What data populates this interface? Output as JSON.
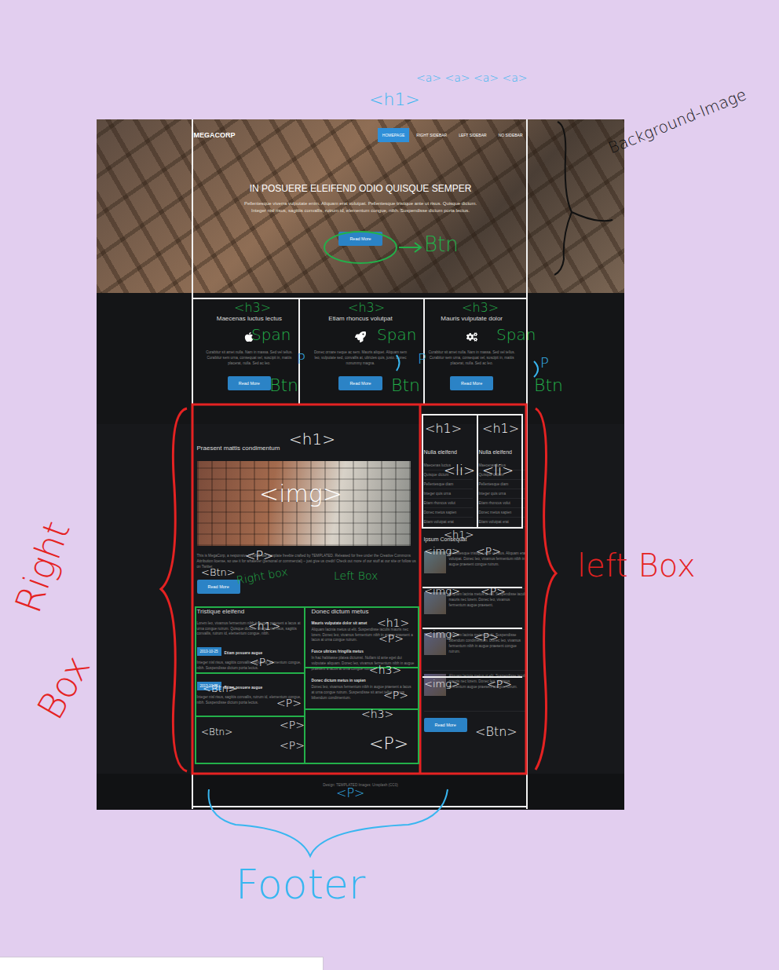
{
  "site": {
    "logo": "MEGACORP",
    "nav": [
      {
        "label": "HOMEPAGE",
        "selected": true
      },
      {
        "label": "RIGHT SIDEBAR",
        "selected": false
      },
      {
        "label": "LEFT SIDEBAR",
        "selected": false
      },
      {
        "label": "NO SIDEBAR",
        "selected": false
      }
    ],
    "hero": {
      "title": "IN POSUERE ELEIFEND ODIO QUISQUE SEMPER",
      "text": "Pellentesque viverra vulputate enim. Aliquam erat volutpat. Pellentesque tristique ante ut risus. Quisque dictum. Integer nisl risus, sagittis convallis, rutrum id, elementum congue, nibh. Suspendisse dictum porta lectus.",
      "button": "Read More"
    },
    "features": [
      {
        "title": "Maecenas luctus lectus",
        "text": "Curabitur sit amet nulla. Nam in massa. Sed vel tellus. Curabitur sem urna, consequat vel, suscipit in, mattis placerat, nulla. Sed ac leo.",
        "button": "Read More"
      },
      {
        "title": "Etiam rhoncus volutpat",
        "text": "Donec ornare neque ac sem. Mauris aliquet. Aliquam sem leo, vulputate sed, convallis at, ultricies quis, justo. Donec nonummy magna.",
        "button": "Read More"
      },
      {
        "title": "Mauris vulputate dolor",
        "text": "Curabitur sit amet nulla. Nam in massa. Sed vel tellus. Curabitur sem urna, consequat vel, suscipit in, mattis placerat, nulla. Sed ac leo.",
        "button": "Read More"
      }
    ],
    "main": {
      "title": "Praesent mattis condimentum",
      "text": "This is MegaCorp, a responsive HTML5 site template freebie crafted by TEMPLATED. Released for free under the Creative Commons Attribution license, so use it for whatever (personal or commercial) – just give us credit! Check out more of our stuff at our site or follow us on Twitter.",
      "button": "Read More"
    },
    "intro": {
      "title": "Tristique eleifend",
      "text": "Lorem leo, vivamus fermentum nibh in augue praesent a lacus at urna congue rutrum. Quisque dictum. Integer nisl risus, sagittis convallis, rutrum id, elementum congue, nibh."
    },
    "posts": [
      {
        "date": "2013-10-25",
        "title": "Etiam posuere augue",
        "text": "Integer nisl risus, sagittis convallis, rutrum id, elementum congue, nibh. Suspendisse dictum porta lectus."
      },
      {
        "date": "2013-10-25",
        "title": "Etiam posuere augue",
        "text": "Integer nisl risus, sagittis convallis, rutrum id, elementum congue, nibh. Suspendisse dictum porta lectus."
      }
    ],
    "articles": {
      "title": "Donec dictum metus",
      "items": [
        {
          "title": "Mauris vulputate dolor sit amet",
          "text": "Aliquam lacinia metus ut elit. Suspendisse iaculis mauris nec lorem. Donec leo, vivamus fermentum nibh in augue praesent a lacus at urna congue rutrum."
        },
        {
          "title": "Fusce ultrices fringilla metus",
          "text": "In hac habitasse platea dictumst. Nullam id ante eget dui vulputate aliquam. Donec leo, vivamus fermentum nibh in augue praesent a lacus at urna congue rutrum."
        },
        {
          "title": "Donec dictum metus in sapien",
          "text": "Donec leo, vivamus fermentum nibh in augue praesent a lacus at urna congue rutrum. Suspendisse sit amet tellus in eros bibendum condimentum."
        }
      ]
    },
    "lists": [
      {
        "title": "Nulla eleifend",
        "items": [
          "Maecenas luctus",
          "Quisque dictum",
          "Pellentesque diam",
          "Integer quis urna",
          "Etiam rhoncus volut",
          "Donec metus sapien",
          "Etiam volutpat erat"
        ]
      },
      {
        "title": "Nulla eleifend",
        "items": [
          "Maecenas luctus",
          "Quisque dictum",
          "Pellentesque diam",
          "Integer quis urna",
          "Etiam rhoncus volut",
          "Donec metus sapien",
          "Etiam volutpat erat"
        ]
      }
    ],
    "gallery": {
      "title": "Ipsum Consequat",
      "items": [
        "Pellentesque tristique ante ut risus. Aliquam erat volutpat. Donec leo, vivamus fermentum nibh in augue praesent congue rutrum.",
        "Aliquam lacinia metus ut elit. Suspendisse iaculis mauris nec lorem. Donec leo, vivamus fermentum augue praesent.",
        "Aliquam lacinia metus ut elit. Suspendisse bibendum condimentum. Donec leo, vivamus fermentum nibh in augue praesent congue rutrum.",
        "Aliquam lacinia metus ut elit. Suspendisse iaculis mauris nec lorem. Donec leo, vivamus fermentum augue praesent congue rutrum."
      ],
      "button": "Read More"
    },
    "footer": "Design: TEMPLATED Images: Unsplash (CC0)"
  },
  "annotations": [
    {
      "text": "<h1>",
      "color": "#38b6f0"
    },
    {
      "text": "<a> <a> <a> <a>",
      "color": "#38b6f0"
    },
    {
      "text": "Background-Image",
      "color": "#111111"
    },
    {
      "text": "Btn",
      "color": "#23b04a"
    },
    {
      "text": "<h3>",
      "color": "#23b04a"
    },
    {
      "text": "<h3>",
      "color": "#23b04a"
    },
    {
      "text": "<h3>",
      "color": "#23b04a"
    },
    {
      "text": "Span",
      "color": "#23b04a"
    },
    {
      "text": "Span",
      "color": "#23b04a"
    },
    {
      "text": "Span",
      "color": "#23b04a"
    },
    {
      "text": "P",
      "color": "#38b6f0"
    },
    {
      "text": "P",
      "color": "#38b6f0"
    },
    {
      "text": "P",
      "color": "#38b6f0"
    },
    {
      "text": "Btn",
      "color": "#23b04a"
    },
    {
      "text": "Btn",
      "color": "#23b04a"
    },
    {
      "text": "Btn",
      "color": "#23b04a"
    },
    {
      "text": "<h1>",
      "color": "#ffffff"
    },
    {
      "text": "<img>",
      "color": "#ffffff"
    },
    {
      "text": "<P>",
      "color": "#ffffff"
    },
    {
      "text": "<Btn>",
      "color": "#ffffff"
    },
    {
      "text": "Right box",
      "color": "#23b04a"
    },
    {
      "text": "Left Box",
      "color": "#23b04a"
    },
    {
      "text": "<h1>",
      "color": "#ffffff"
    },
    {
      "text": "<h1>",
      "color": "#ffffff"
    },
    {
      "text": "<li>",
      "color": "#ffffff"
    },
    {
      "text": "<li>",
      "color": "#ffffff"
    },
    {
      "text": "<h1>",
      "color": "#ffffff"
    },
    {
      "text": "<img>",
      "color": "#ffffff"
    },
    {
      "text": "<P>",
      "color": "#ffffff"
    },
    {
      "text": "<img>",
      "color": "#ffffff"
    },
    {
      "text": "<P>",
      "color": "#ffffff"
    },
    {
      "text": "<img>",
      "color": "#ffffff"
    },
    {
      "text": "<P>",
      "color": "#ffffff"
    },
    {
      "text": "<img>",
      "color": "#ffffff"
    },
    {
      "text": "<P>",
      "color": "#ffffff"
    },
    {
      "text": "<Btn>",
      "color": "#ffffff"
    },
    {
      "text": "<h1>",
      "color": "#ffffff"
    },
    {
      "text": "<P>",
      "color": "#ffffff"
    },
    {
      "text": "<Btn>",
      "color": "#ffffff"
    },
    {
      "text": "<P>",
      "color": "#ffffff"
    },
    {
      "text": "<Btn>",
      "color": "#ffffff"
    },
    {
      "text": "<P>",
      "color": "#ffffff"
    },
    {
      "text": "<P>",
      "color": "#ffffff"
    },
    {
      "text": "<h1>",
      "color": "#ffffff"
    },
    {
      "text": "<P>",
      "color": "#ffffff"
    },
    {
      "text": "<h3>",
      "color": "#ffffff"
    },
    {
      "text": "<P>",
      "color": "#ffffff"
    },
    {
      "text": "<h3>",
      "color": "#ffffff"
    },
    {
      "text": "<P>",
      "color": "#ffffff"
    },
    {
      "text": "left Box",
      "color": "#e52222"
    },
    {
      "text": "Right",
      "color": "#e52222"
    },
    {
      "text": "Box",
      "color": "#e52222"
    },
    {
      "text": "<P>",
      "color": "#38b6f0"
    },
    {
      "text": "Footer",
      "color": "#38b6f0"
    }
  ]
}
